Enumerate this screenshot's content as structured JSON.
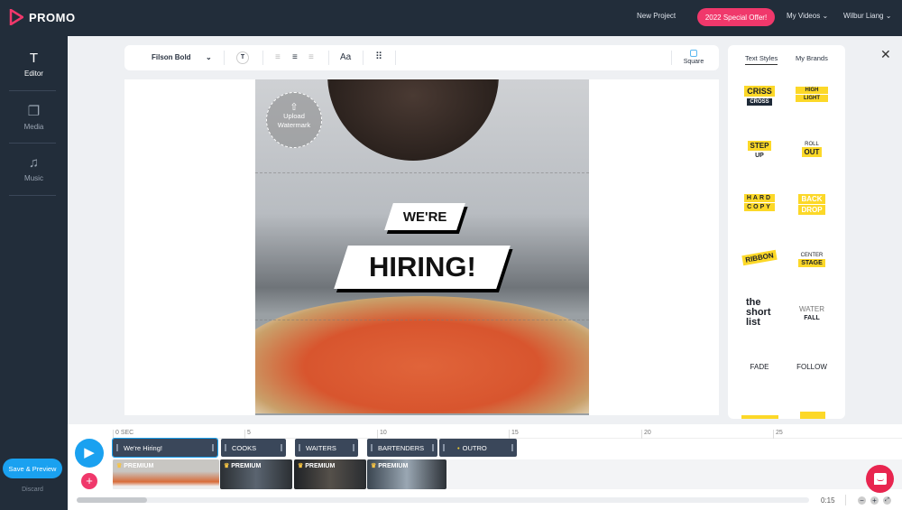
{
  "app": {
    "name": "PROMO",
    "brand_color": "#f0386b",
    "accent": "#1aa1f0"
  },
  "topnav": {
    "new_project": "New Project",
    "offer": "2022 Special Offer!",
    "my_videos": "My Videos",
    "user": "Wilbur Liang"
  },
  "sidebar": {
    "items": [
      {
        "label": "Editor",
        "icon": "text-icon"
      },
      {
        "label": "Media",
        "icon": "media-icon"
      },
      {
        "label": "Music",
        "icon": "music-icon"
      }
    ],
    "save": "Save & Preview",
    "discard": "Discard"
  },
  "toolbar": {
    "font": "Filson Bold",
    "case": "Aa",
    "format": "Square"
  },
  "canvas": {
    "watermark": "Upload Watermark",
    "line1": "WE'RE",
    "line2": "HIRING!"
  },
  "panel": {
    "tabs": [
      "Text Styles",
      "My Brands"
    ],
    "active_tab": "Text Styles",
    "styles": [
      [
        "CRISS",
        "CROSS"
      ],
      [
        "HIGH",
        "LIGHT"
      ],
      [
        "STEP",
        "UP"
      ],
      [
        "ROLL",
        "OUT"
      ],
      [
        "HARD",
        "COPY"
      ],
      [
        "BACK",
        "DROP"
      ],
      [
        "RIBBON"
      ],
      [
        "CENTER",
        "STAGE"
      ],
      [
        "the",
        "short",
        "list"
      ],
      [
        "WATER",
        "FALL"
      ],
      [
        "FADE"
      ],
      [
        "FOLLOW"
      ]
    ]
  },
  "timeline": {
    "ticks": [
      "0 SEC",
      "5",
      "10",
      "15",
      "20",
      "25"
    ],
    "text_clips": [
      "We're Hiring!",
      "COOKS",
      "WAITERS",
      "BARTENDERS",
      "OUTRO"
    ],
    "video_badge": "PREMIUM",
    "duration": "0:15"
  }
}
